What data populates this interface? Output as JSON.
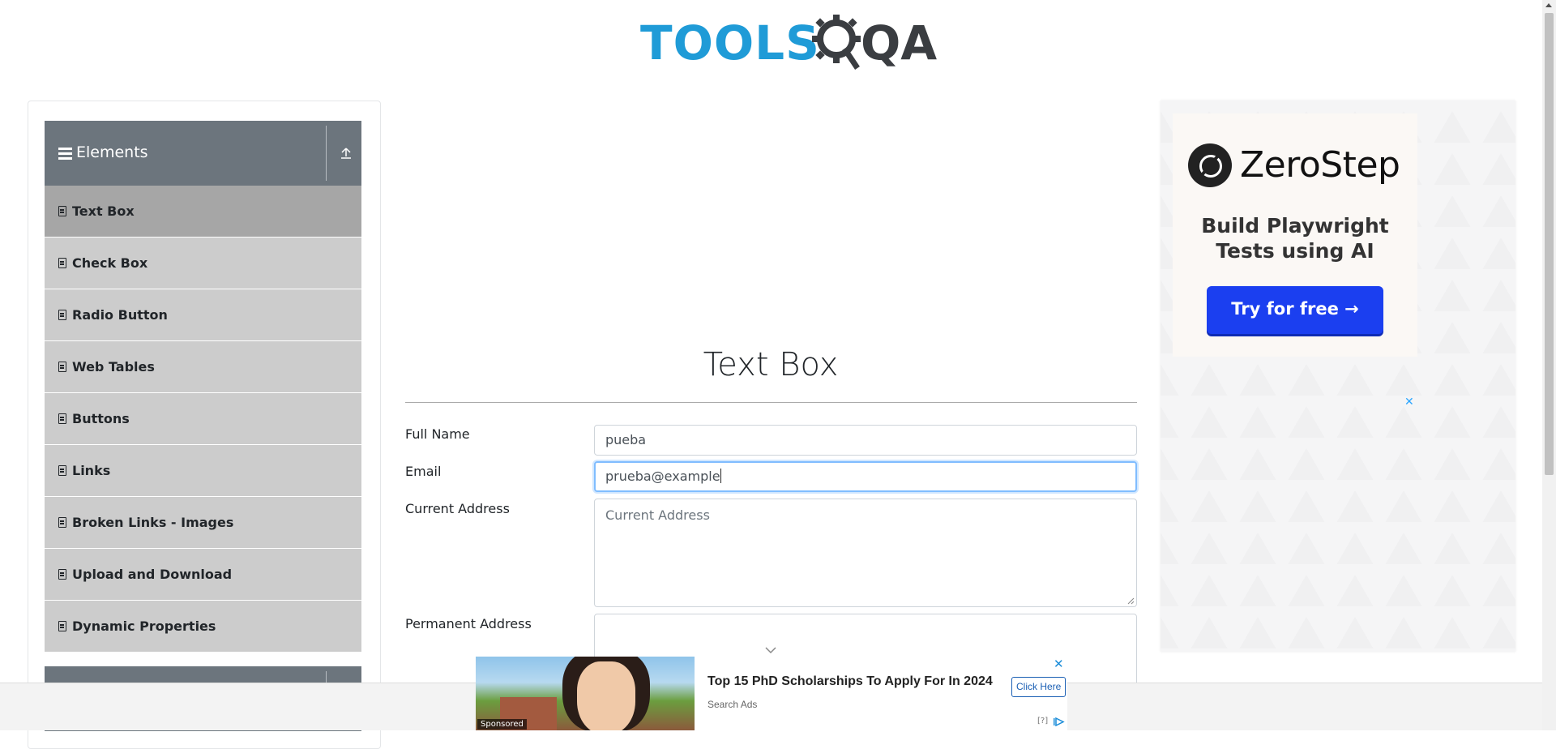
{
  "header": {
    "logo_main": "TOOLS",
    "logo_suffix": "QA"
  },
  "sidebar": {
    "group_title": "Elements",
    "items": [
      {
        "label": "Text Box",
        "active": true
      },
      {
        "label": "Check Box"
      },
      {
        "label": "Radio Button"
      },
      {
        "label": "Web Tables"
      },
      {
        "label": "Buttons"
      },
      {
        "label": "Links"
      },
      {
        "label": "Broken Links - Images"
      },
      {
        "label": "Upload and Download"
      },
      {
        "label": "Dynamic Properties"
      }
    ]
  },
  "main": {
    "title": "Text Box",
    "full_name": {
      "label": "Full Name",
      "value": "pueba"
    },
    "email": {
      "label": "Email",
      "value": "prueba@example"
    },
    "current_address": {
      "label": "Current Address",
      "placeholder": "Current Address"
    },
    "permanent_address": {
      "label": "Permanent Address"
    }
  },
  "right_ad": {
    "brand": "ZeroStep",
    "headline": "Build Playwright Tests using AI",
    "cta": "Try for free →",
    "close": "✕"
  },
  "bottom_ad": {
    "badge": "Sponsored",
    "title": "Top 15 PhD Scholarships To Apply For In 2024",
    "source": "Search Ads",
    "cta": "Click Here",
    "close": "✕",
    "info": "[?]"
  },
  "colors": {
    "accent": "#1f9bd7",
    "sidebar_header": "#6c757d",
    "menu_item": "#cccccc",
    "menu_active": "#a6a6a6",
    "ad_cta": "#1b3ff0"
  }
}
